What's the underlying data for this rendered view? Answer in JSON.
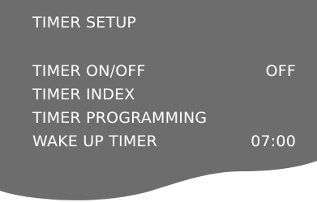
{
  "panel": {
    "background_color": "#6d6d6d",
    "text_color": "#ffffff"
  },
  "menu": {
    "title": "TIMER SETUP",
    "items": [
      {
        "label": "TIMER ON/OFF",
        "value": "OFF"
      },
      {
        "label": "TIMER INDEX",
        "value": ""
      },
      {
        "label": "TIMER PROGRAMMING",
        "value": ""
      },
      {
        "label": "WAKE UP TIMER",
        "value": "07:00"
      }
    ]
  }
}
